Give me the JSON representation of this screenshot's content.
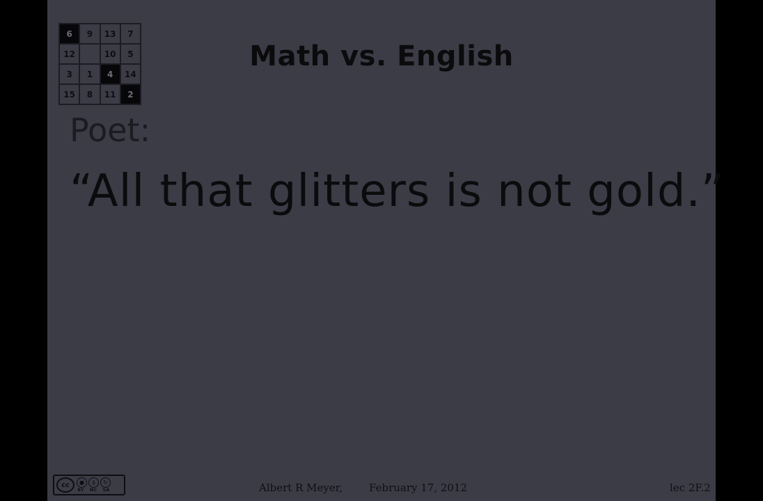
{
  "slide": {
    "title": "Math vs. English",
    "poet_label": "Poet:",
    "quote": "“All that glitters is not gold.”"
  },
  "puzzle": {
    "tiles": [
      "6",
      "9",
      "13",
      "7",
      "12",
      "",
      "10",
      "5",
      "3",
      "1",
      "4",
      "14",
      "15",
      "8",
      "11",
      "2"
    ],
    "dark_tiles": [
      "6",
      "4",
      "2"
    ]
  },
  "footer": {
    "author": "Albert R Meyer,",
    "date": "February 17, 2012",
    "lecture": "lec 2F.2",
    "license_labels": [
      "BY",
      "NC",
      "SA"
    ],
    "license_mark": "cc"
  },
  "colors": {
    "slide_background": "#3b3c46",
    "text": "#0b0b0d",
    "frame": "#000000"
  }
}
